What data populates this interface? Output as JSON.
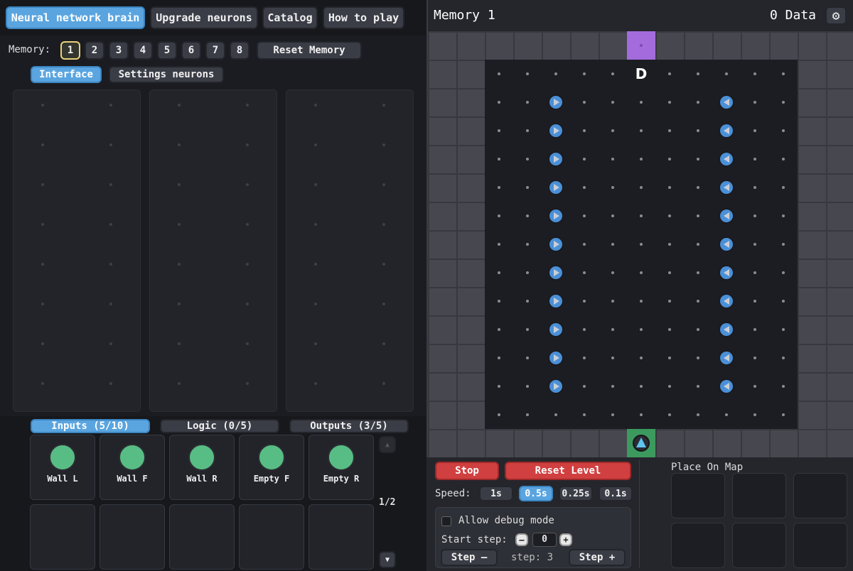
{
  "nav": {
    "brain": "Neural network brain",
    "upgrade": "Upgrade neurons",
    "catalog": "Catalog",
    "howto": "How to play"
  },
  "memory": {
    "label": "Memory:",
    "slots": [
      "1",
      "2",
      "3",
      "4",
      "5",
      "6",
      "7",
      "8"
    ],
    "selected": "1",
    "reset": "Reset Memory"
  },
  "subtabs": {
    "interface": "Interface",
    "settings": "Settings neurons"
  },
  "bottom_tabs": {
    "inputs": "Inputs (5/10)",
    "logic": "Logic (0/5)",
    "outputs": "Outputs (3/5)"
  },
  "inputs": [
    "Wall L",
    "Wall F",
    "Wall R",
    "Empty F",
    "Empty R"
  ],
  "page_indicator": "1/2",
  "map": {
    "title": "Memory 1",
    "data": "0 Data",
    "goal_letter": "D"
  },
  "controls": {
    "stop": "Stop",
    "reset_level": "Reset Level",
    "speed_label": "Speed:",
    "speeds": [
      "1s",
      "0.5s",
      "0.25s",
      "0.1s"
    ],
    "speed_selected": "0.5s",
    "debug_label": "Allow debug mode",
    "start_step_label": "Start step:",
    "start_step_value": "0",
    "minus": "–",
    "plus": "+",
    "step_back": "Step –",
    "step_current": "step: 3",
    "step_fwd": "Step +",
    "place_on_map": "Place On Map"
  },
  "colors": {
    "accent": "#5aa5e0",
    "input_orb": "#58bd84",
    "goal_tile": "#a36bdc",
    "start_tile": "#3c9a5e",
    "stop": "#d04040"
  }
}
